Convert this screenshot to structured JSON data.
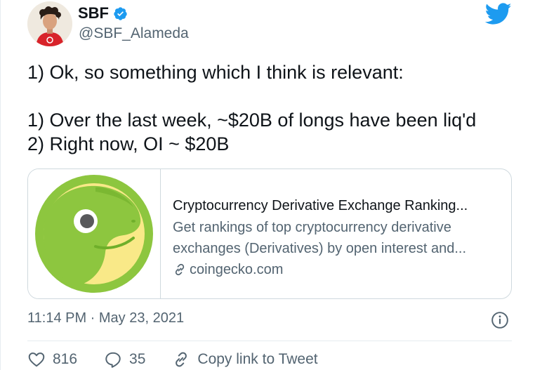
{
  "user": {
    "display_name": "SBF",
    "handle": "@SBF_Alameda",
    "verified": true
  },
  "tweet": {
    "lines": [
      "1) Ok, so something which I think is relevant:",
      "1) Over the last week, ~$20B of longs have been liq'd",
      "2) Right now, OI ~ $20B"
    ],
    "timestamp": "11:14 PM · May 23, 2021"
  },
  "link_card": {
    "title": "Cryptocurrency Derivative Exchange Ranking...",
    "description_line1": "Get rankings of top cryptocurrency derivative",
    "description_line2": "exchanges (Derivatives) by open interest and...",
    "domain": "coingecko.com"
  },
  "actions": {
    "likes": "816",
    "replies": "35",
    "copy_link_label": "Copy link to Tweet"
  },
  "colors": {
    "brand_blue": "#1d9bf0",
    "secondary_text": "#536471",
    "coingecko_green": "#8dc63f"
  }
}
